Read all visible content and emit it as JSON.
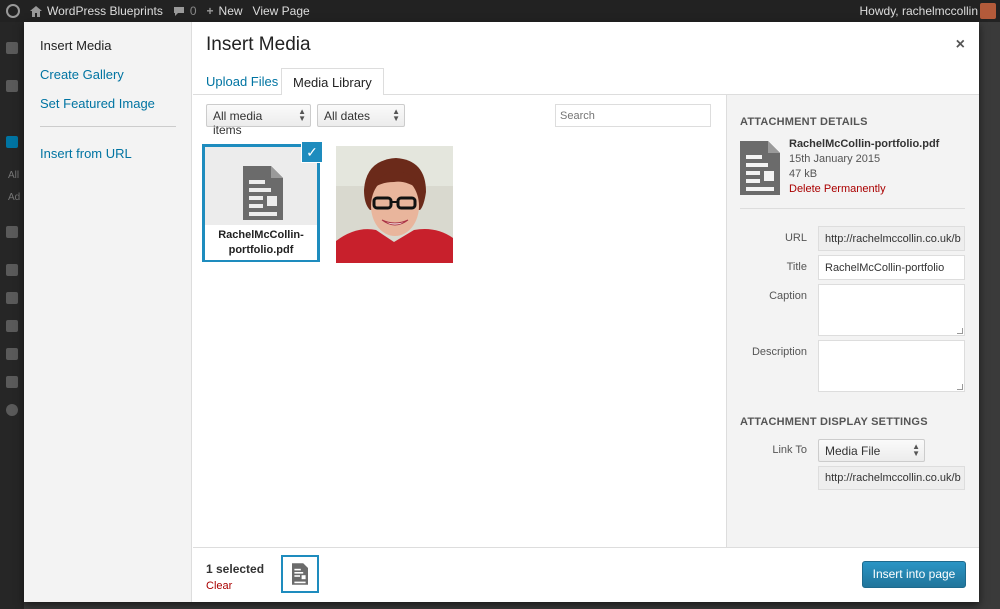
{
  "admin_bar": {
    "site_name": "WordPress Blueprints",
    "comments_count": "0",
    "new_label": "New",
    "view_page_label": "View Page",
    "howdy": "Howdy, rachelmccollin"
  },
  "admin_menu": {
    "fragment_all": "All",
    "fragment_ad": "Ad"
  },
  "modal_menu": {
    "items": [
      {
        "label": "Insert Media",
        "active": true
      },
      {
        "label": "Create Gallery"
      },
      {
        "label": "Set Featured Image"
      },
      {
        "label": "Insert from URL"
      }
    ]
  },
  "frame": {
    "title": "Insert Media",
    "close_glyph": "×",
    "tabs": [
      {
        "label": "Upload Files"
      },
      {
        "label": "Media Library",
        "active": true
      }
    ]
  },
  "filters": {
    "media_type": "All media items",
    "dates": "All dates",
    "search_placeholder": "Search"
  },
  "attachments": [
    {
      "filename": "RachelMcCollin-portfolio.pdf",
      "selected": true,
      "type": "document"
    },
    {
      "type": "image",
      "alt": "portrait photo"
    }
  ],
  "details": {
    "heading": "Attachment Details",
    "filename": "RachelMcCollin-portfolio.pdf",
    "date": "15th January 2015",
    "size": "47 kB",
    "delete_label": "Delete Permanently",
    "url_label": "URL",
    "url_value": "http://rachelmccollin.co.uk/b",
    "title_label": "Title",
    "title_value": "RachelMcCollin-portfolio",
    "caption_label": "Caption",
    "caption_value": "",
    "description_label": "Description",
    "description_value": ""
  },
  "display_settings": {
    "heading": "Attachment Display Settings",
    "link_to_label": "Link To",
    "link_to_value": "Media File",
    "link_url": "http://rachelmccollin.co.uk/b"
  },
  "toolbar": {
    "selected_count": "1 selected",
    "clear_label": "Clear",
    "insert_label": "Insert into page"
  },
  "colors": {
    "accent": "#1e8cbe",
    "link": "#0074a2",
    "danger": "#aa0000",
    "primary_button": "#2a95c5"
  }
}
